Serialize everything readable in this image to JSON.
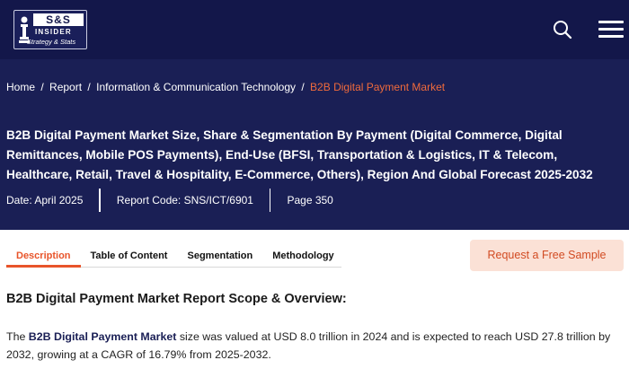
{
  "header": {
    "logo": {
      "brand": "S&S",
      "insider": "INSIDER",
      "tagline": "Strategy & Stats"
    },
    "icons": [
      "search-icon",
      "hamburger-menu-icon"
    ]
  },
  "breadcrumb": {
    "items": [
      "Home",
      "Report",
      "Information & Communication Technology"
    ],
    "current": "B2B Digital Payment Market",
    "separator": "/"
  },
  "report": {
    "title": "B2B Digital Payment Market Size, Share & Segmentation By Payment (Digital Commerce, Digital Remittances, Mobile POS Payments), End-Use (BFSI, Transportation & Logistics, IT & Telecom, Healthcare, Retail, Travel & Hospitality, E-Commerce, Others), Region And Global Forecast 2025-2032",
    "date": "Date: April 2025",
    "report_code": "Report Code: SNS/ICT/6901",
    "pages": "Page 350"
  },
  "tabs": [
    {
      "label": "Description",
      "active": true
    },
    {
      "label": "Table of Content",
      "active": false
    },
    {
      "label": "Segmentation",
      "active": false
    },
    {
      "label": "Methodology",
      "active": false
    }
  ],
  "cta": {
    "request_sample": "Request a Free Sample"
  },
  "content": {
    "section_title": "B2B Digital Payment Market Report Scope & Overview:",
    "intro_prefix": "The ",
    "intro_bold": "B2B Digital Payment Market",
    "intro_rest": " size was valued at USD 8.0 trillion in 2024 and is expected to reach USD 27.8 trillion by 2032, growing at a CAGR of 16.79% from 2025-2032."
  },
  "colors": {
    "header_bg": "#13174a",
    "hero_bg": "#1a1f55",
    "accent": "#e8542a",
    "cta_bg": "#fbe1d6"
  }
}
